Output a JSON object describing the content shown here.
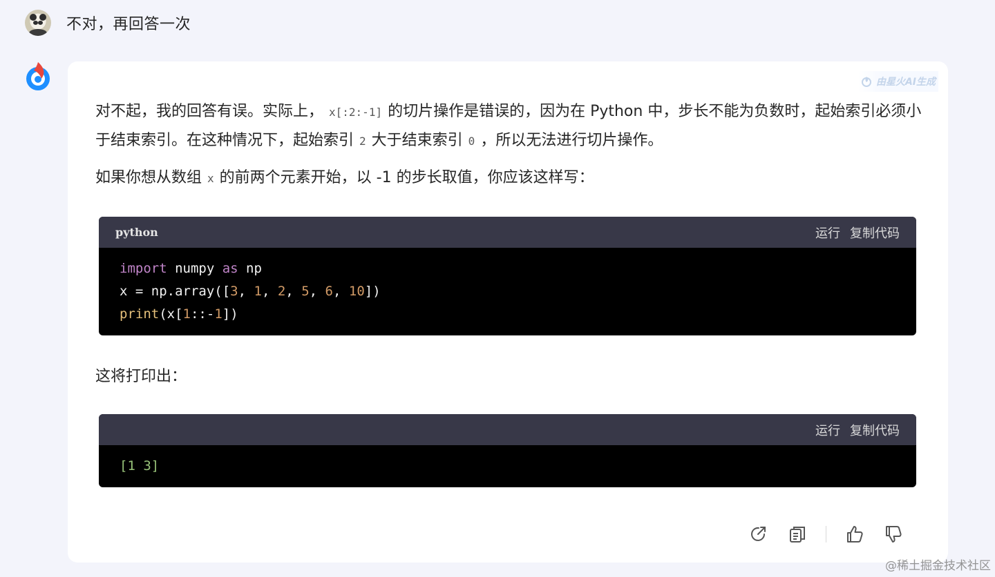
{
  "user": {
    "message": "不对，再回答一次"
  },
  "ai_badge": "由星火AI生成",
  "answer": {
    "p1_a": "对不起，我的回答有误。实际上，",
    "p1_code": "x[:2:-1]",
    "p1_b": "的切片操作是错误的，因为在 Python 中，步长不能为负数时，起始索引必须小于结束索引。在这种情况下，起始索引",
    "p1_code2": "2",
    "p1_c": "大于结束索引",
    "p1_code3": "0",
    "p1_d": "，所以无法进行切片操作。",
    "p2_a": "如果你想从数组",
    "p2_code": "x",
    "p2_b": "的前两个元素开始，以 -1 的步长取值，你应该这样写：",
    "p3": "这将打印出："
  },
  "code1": {
    "lang": "python",
    "run_label": "运行",
    "copy_label": "复制代码",
    "line1_kw1": "import",
    "line1_mid": " numpy ",
    "line1_kw2": "as",
    "line1_end": " np",
    "line2_a": "x = np.array([",
    "line2_n1": "3",
    "line2_n2": "1",
    "line2_n3": "2",
    "line2_n4": "5",
    "line2_n5": "6",
    "line2_n6": "10",
    "line2_end": "])",
    "line3_fn": "print",
    "line3_a": "(x[",
    "line3_n1": "1",
    "line3_b": "::-",
    "line3_n2": "1",
    "line3_end": "])"
  },
  "code2": {
    "run_label": "运行",
    "copy_label": "复制代码",
    "output": "[1 3]"
  },
  "toolbar": {
    "icons": [
      "share-icon",
      "copy-icon",
      "thumbs-up-icon",
      "thumbs-down-icon"
    ]
  },
  "watermark": "@稀土掘金技术社区",
  "colors": {
    "background": "#f3f4fb",
    "code_header": "#383848",
    "code_body": "#000000",
    "brand_blue": "#1e90ff",
    "brand_red": "#e8473c"
  }
}
